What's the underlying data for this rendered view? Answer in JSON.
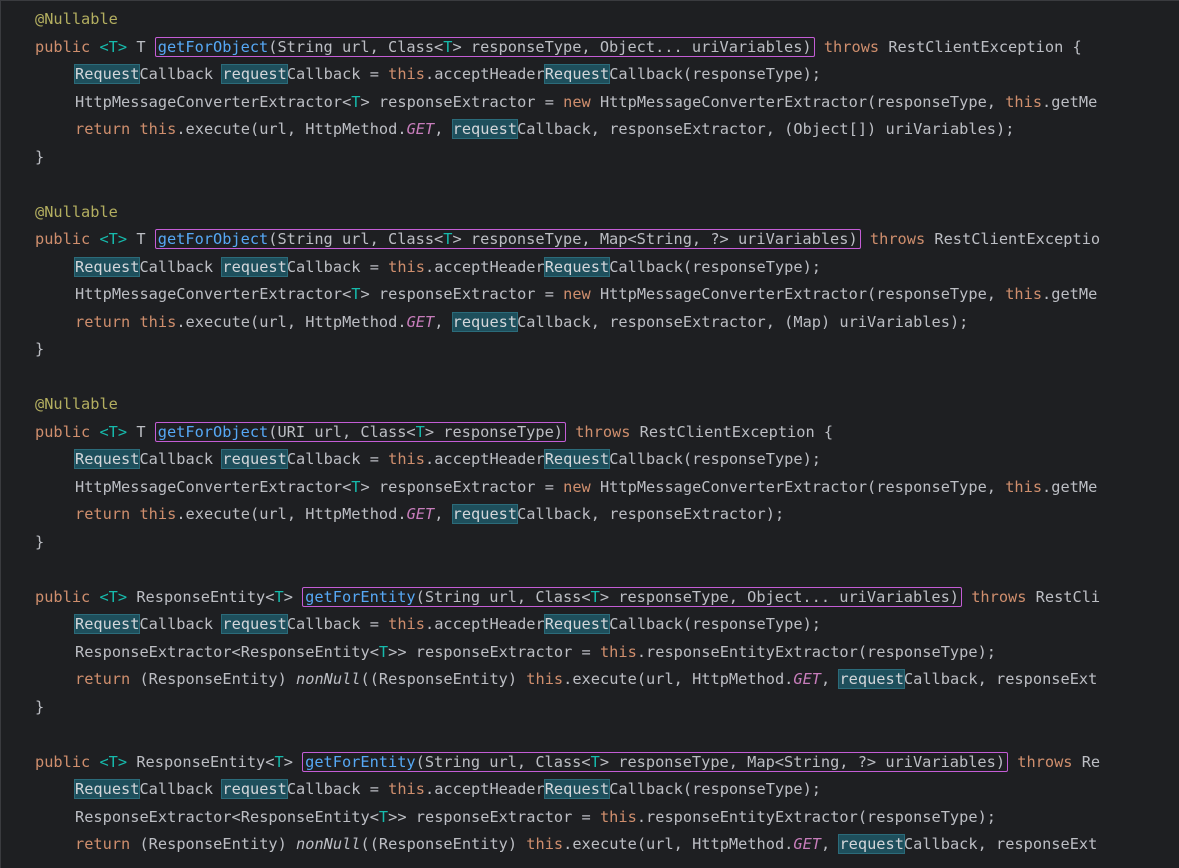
{
  "methods": [
    {
      "annotation": "@Nullable",
      "sig_pre_kw": "public ",
      "sig_t1": "<T>",
      "sig_ret": " T ",
      "sig_boxed_name": "getForObject",
      "sig_boxed_rest": "(String url, Class<",
      "sig_boxed_t": "T",
      "sig_boxed_tail": "> responseType, Object... uriVariables)",
      "sig_after_kw": " throws",
      "sig_after": " RestClientException {",
      "line2_a": "Request",
      "line2_b": "Callback ",
      "line2_c": "request",
      "line2_d": "Callback = ",
      "line2_this": "this",
      "line2_e": ".acceptHeader",
      "line2_f": "Request",
      "line2_g": "Callback(responseType);",
      "line3_a": "HttpMessageConverterExtractor<",
      "line3_t": "T",
      "line3_b": "> responseExtractor = ",
      "line3_new": "new",
      "line3_c": " HttpMessageConverterExtractor(responseType, ",
      "line3_this": "this",
      "line3_d": ".getMe",
      "line4_ret": "return ",
      "line4_this": "this",
      "line4_a": ".execute(url, HttpMethod.",
      "line4_get": "GET",
      "line4_b": ", ",
      "line4_req": "request",
      "line4_c": "Callback, responseExtractor, (Object[]) uriVariables);",
      "close": "}"
    },
    {
      "annotation": "@Nullable",
      "sig_pre_kw": "public ",
      "sig_t1": "<T>",
      "sig_ret": " T ",
      "sig_boxed_name": "getForObject",
      "sig_boxed_rest": "(String url, Class<",
      "sig_boxed_t": "T",
      "sig_boxed_tail": "> responseType, Map<String, ?> uriVariables)",
      "sig_after_kw": " throws",
      "sig_after": " RestClientExceptio",
      "line2_a": "Request",
      "line2_b": "Callback ",
      "line2_c": "request",
      "line2_d": "Callback = ",
      "line2_this": "this",
      "line2_e": ".acceptHeader",
      "line2_f": "Request",
      "line2_g": "Callback(responseType);",
      "line3_a": "HttpMessageConverterExtractor<",
      "line3_t": "T",
      "line3_b": "> responseExtractor = ",
      "line3_new": "new",
      "line3_c": " HttpMessageConverterExtractor(responseType, ",
      "line3_this": "this",
      "line3_d": ".getMe",
      "line4_ret": "return ",
      "line4_this": "this",
      "line4_a": ".execute(url, HttpMethod.",
      "line4_get": "GET",
      "line4_b": ", ",
      "line4_req": "request",
      "line4_c": "Callback, responseExtractor, (Map) uriVariables);",
      "close": "}"
    },
    {
      "annotation": "@Nullable",
      "sig_pre_kw": "public ",
      "sig_t1": "<T>",
      "sig_ret": " T ",
      "sig_boxed_name": "getForObject",
      "sig_boxed_rest": "(URI url, Class<",
      "sig_boxed_t": "T",
      "sig_boxed_tail": "> responseType)",
      "sig_after_kw": " throws",
      "sig_after": " RestClientException {",
      "line2_a": "Request",
      "line2_b": "Callback ",
      "line2_c": "request",
      "line2_d": "Callback = ",
      "line2_this": "this",
      "line2_e": ".acceptHeader",
      "line2_f": "Request",
      "line2_g": "Callback(responseType);",
      "line3_a": "HttpMessageConverterExtractor<",
      "line3_t": "T",
      "line3_b": "> responseExtractor = ",
      "line3_new": "new",
      "line3_c": " HttpMessageConverterExtractor(responseType, ",
      "line3_this": "this",
      "line3_d": ".getMe",
      "line4_ret": "return ",
      "line4_this": "this",
      "line4_a": ".execute(url, HttpMethod.",
      "line4_get": "GET",
      "line4_b": ", ",
      "line4_req": "request",
      "line4_c": "Callback, responseExtractor);",
      "close": "}"
    }
  ],
  "entity_methods": [
    {
      "sig_pre_kw": "public ",
      "sig_t1": "<T>",
      "sig_ret_a": " ResponseEntity<",
      "sig_ret_t": "T",
      "sig_ret_b": "> ",
      "sig_boxed_name": "getForEntity",
      "sig_boxed_rest": "(String url, Class<",
      "sig_boxed_t": "T",
      "sig_boxed_tail": "> responseType, Object... uriVariables)",
      "sig_after_kw": " throws",
      "sig_after": " RestCli",
      "line2_a": "Request",
      "line2_b": "Callback ",
      "line2_c": "request",
      "line2_d": "Callback = ",
      "line2_this": "this",
      "line2_e": ".acceptHeader",
      "line2_f": "Request",
      "line2_g": "Callback(responseType);",
      "line3_a": "ResponseExtractor<ResponseEntity<",
      "line3_t": "T",
      "line3_b": ">> responseExtractor = ",
      "line3_this": "this",
      "line3_c": ".responseEntityExtractor(responseType);",
      "line4_ret": "return",
      "line4_a": " (ResponseEntity) ",
      "line4_nn": "nonNull",
      "line4_b": "((ResponseEntity) ",
      "line4_this": "this",
      "line4_c": ".execute(url, HttpMethod.",
      "line4_get": "GET",
      "line4_d": ", ",
      "line4_req": "request",
      "line4_e": "Callback, responseExt",
      "close": "}"
    },
    {
      "sig_pre_kw": "public ",
      "sig_t1": "<T>",
      "sig_ret_a": " ResponseEntity<",
      "sig_ret_t": "T",
      "sig_ret_b": "> ",
      "sig_boxed_name": "getForEntity",
      "sig_boxed_rest": "(String url, Class<",
      "sig_boxed_t": "T",
      "sig_boxed_tail": "> responseType, Map<String, ?> uriVariables)",
      "sig_after_kw": " throws",
      "sig_after": " Re",
      "line2_a": "Request",
      "line2_b": "Callback ",
      "line2_c": "request",
      "line2_d": "Callback = ",
      "line2_this": "this",
      "line2_e": ".acceptHeader",
      "line2_f": "Request",
      "line2_g": "Callback(responseType);",
      "line3_a": "ResponseExtractor<ResponseEntity<",
      "line3_t": "T",
      "line3_b": ">> responseExtractor = ",
      "line3_this": "this",
      "line3_c": ".responseEntityExtractor(responseType);",
      "line4_ret": "return",
      "line4_a": " (ResponseEntity) ",
      "line4_nn": "nonNull",
      "line4_b": "((ResponseEntity) ",
      "line4_this": "this",
      "line4_c": ".execute(url, HttpMethod.",
      "line4_get": "GET",
      "line4_d": ", ",
      "line4_req": "request",
      "line4_e": "Callback, responseExt",
      "close": ""
    }
  ],
  "colors": {
    "background": "#1e1f22",
    "keyword": "#cf8e6d",
    "annotation": "#b3ae60",
    "type_param": "#16baac",
    "function": "#56a8f5",
    "constant": "#c77dbb",
    "highlight_bg": "#1e4f5c",
    "box_border": "#c45dd6"
  }
}
